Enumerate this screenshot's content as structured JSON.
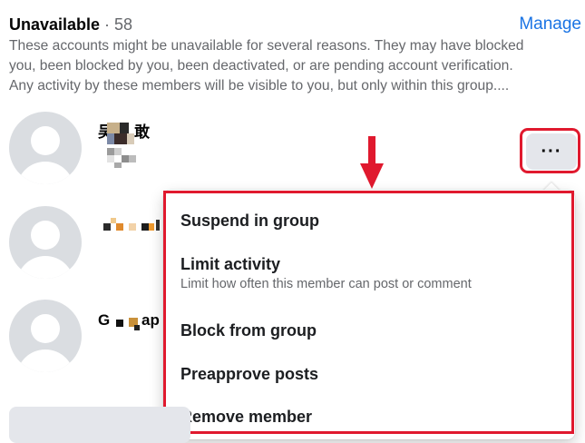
{
  "section": {
    "title": "Unavailable",
    "separator": " · ",
    "count": "58",
    "manage_label": "Manage",
    "description_lines": [
      "These accounts might be unavailable for several reasons. They may have blocked",
      "you, been blocked by you, been deactivated, or are pending account verification.",
      "Any activity by these members will be visible to you, but only within this group...."
    ]
  },
  "members": [
    {
      "name_visible": "吴",
      "name_tail": "敢"
    },
    {
      "name_visible": "",
      "name_tail": ""
    },
    {
      "name_visible": "G",
      "name_tail": "ap"
    }
  ],
  "more_button": {
    "label": "···",
    "icon": "more-horiz-icon"
  },
  "menu": {
    "items": [
      {
        "label": "Suspend in group",
        "sublabel": ""
      },
      {
        "label": "Limit activity",
        "sublabel": "Limit how often this member can post or comment"
      },
      {
        "label": "Block from group",
        "sublabel": ""
      },
      {
        "label": "Preapprove posts",
        "sublabel": ""
      },
      {
        "label": "Remove member",
        "sublabel": ""
      }
    ]
  },
  "colors": {
    "accent": "#1b74e4",
    "annotation_red": "#e0192e",
    "secondary_text": "#65676b"
  }
}
